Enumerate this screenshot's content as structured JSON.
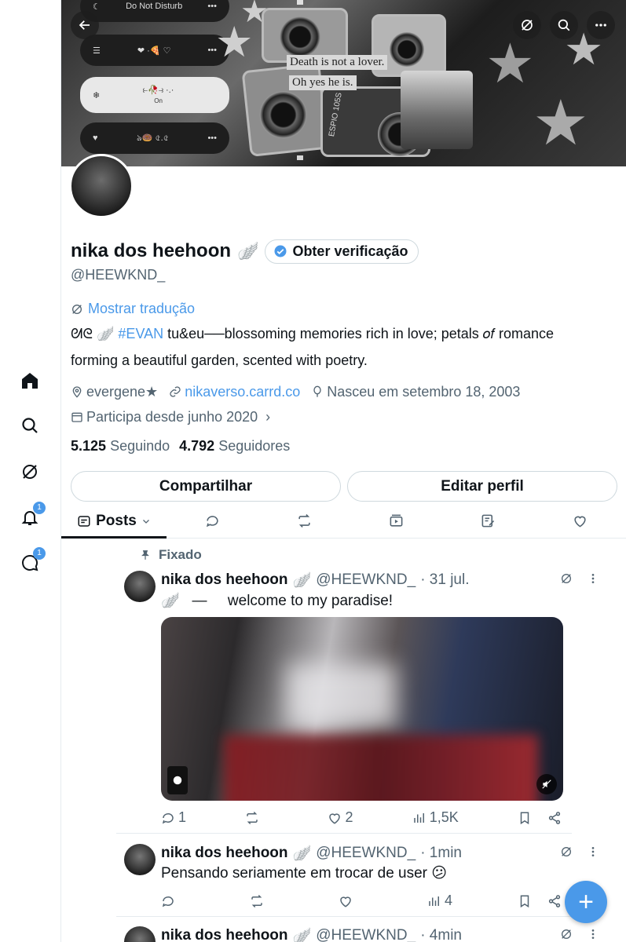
{
  "banner": {
    "pills": [
      "Do Not Disturb",
      "❤ ·🍕 ♡",
      "⥼🥀⥽ ·.·",
      "ঌ🍩 ৫.৫"
    ],
    "pill_on_label": "On",
    "caption_1": "Death is not a lover.",
    "caption_2": "Oh yes he is.",
    "camera_text": "ESPIO 105S"
  },
  "profile": {
    "display_name": "nika dos heehoon",
    "name_emoji": "🪽",
    "verify_label": "Obter verificação",
    "handle": "@HEEWKND_",
    "translate_label": "Mostrar tradução",
    "bio_prefix": "ᘛᘓ 🪽",
    "bio_hashtag": "#EVAN",
    "bio_rest": " tu&eu──blossoming memories rich in love; petals 𝑜𝑓 romance forming a beautiful garden, scented with poetry.",
    "location": "evergene★",
    "website": "nikaverso.carrd.co",
    "birthday": "Nasceu em setembro 18, 2003",
    "joined": "Participa desde junho 2020",
    "following_count": "5.125",
    "following_label": "Seguindo",
    "followers_count": "4.792",
    "followers_label": "Seguidores"
  },
  "buttons": {
    "share": "Compartilhar",
    "edit": "Editar perfil"
  },
  "tabs": {
    "posts": "Posts"
  },
  "rail": {
    "notifications_badge": "1",
    "messages_badge": "1"
  },
  "pinned_label": "Fixado",
  "tweets": [
    {
      "name": "nika dos heehoon",
      "emoji": "🪽",
      "handle": "@HEEWKND_",
      "time": "· 31 jul.",
      "text_emoji": "🪽",
      "text": "   —     welcome to my paradise!",
      "replies": "1",
      "retweets": "",
      "likes": "2",
      "views": "1,5K"
    },
    {
      "name": "nika dos heehoon",
      "emoji": "🪽",
      "handle": "@HEEWKND_",
      "time": "· 1min",
      "text": "Pensando seriamente em trocar de user 😕",
      "replies": "",
      "retweets": "",
      "likes": "",
      "views": "4"
    },
    {
      "name": "nika dos heehoon",
      "emoji": "🪽",
      "handle": "@HEEWKND_",
      "time": "· 4min"
    }
  ],
  "colors": {
    "accent": "#4a99e9",
    "muted": "#536471",
    "text": "#0f1419",
    "border": "#cfd9de"
  }
}
